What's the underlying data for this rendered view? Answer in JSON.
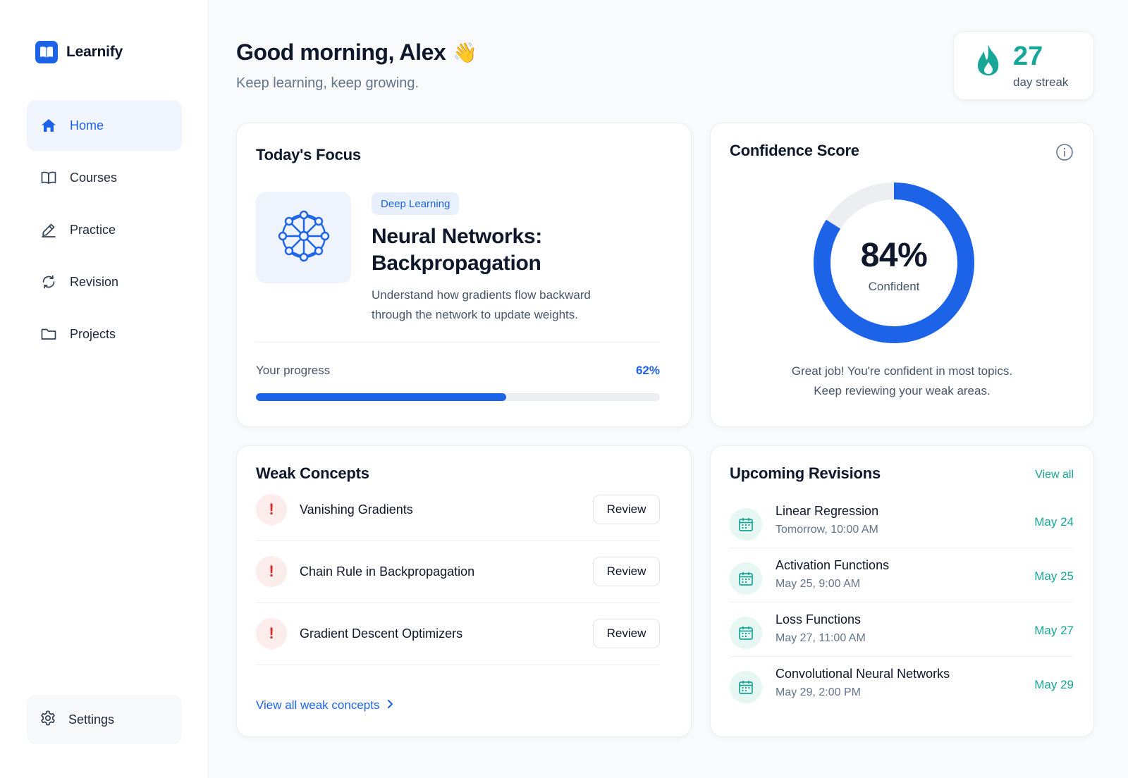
{
  "brand": {
    "name": "Learnify",
    "accent": "#1d63e8"
  },
  "nav": {
    "items": [
      {
        "label": "Home",
        "icon": "home-icon",
        "active": true
      },
      {
        "label": "Courses",
        "icon": "book-icon",
        "active": false
      },
      {
        "label": "Practice",
        "icon": "pencil-icon",
        "active": false
      },
      {
        "label": "Revision",
        "icon": "refresh-icon",
        "active": false
      },
      {
        "label": "Projects",
        "icon": "folder-icon",
        "active": false
      }
    ],
    "settings_label": "Settings"
  },
  "header": {
    "greeting": "Good morning, Alex",
    "emoji": "👋",
    "subtitle": "Keep learning, keep growing."
  },
  "streak": {
    "value": "27",
    "label": "day streak",
    "color": "#17a697"
  },
  "focus": {
    "title": "Today's Focus",
    "tag": "Deep Learning",
    "lesson_title": "Neural Networks: Backpropagation",
    "description": "Understand how gradients flow backward through the network to update weights.",
    "progress_label": "Your progress",
    "progress_text": "62%",
    "progress_value": 0.62
  },
  "confidence": {
    "title": "Confidence Score",
    "value_text": "84%",
    "value": 0.84,
    "label": "Confident",
    "message_line1": "Great job! You're confident in most topics.",
    "message_line2": "Keep reviewing your weak areas."
  },
  "weak": {
    "title": "Weak Concepts",
    "items": [
      {
        "name": "Vanishing Gradients",
        "action": "Review"
      },
      {
        "name": "Chain Rule in Backpropagation",
        "action": "Review"
      },
      {
        "name": "Gradient Descent Optimizers",
        "action": "Review"
      }
    ],
    "view_all": "View all weak concepts"
  },
  "revisions": {
    "title": "Upcoming Revisions",
    "view_all": "View all",
    "items": [
      {
        "title": "Linear Regression",
        "time": "Tomorrow, 10:00 AM",
        "date": "May 24"
      },
      {
        "title": "Activation Functions",
        "time": "May 25, 9:00 AM",
        "date": "May 25"
      },
      {
        "title": "Loss Functions",
        "time": "May 27, 11:00 AM",
        "date": "May 27"
      },
      {
        "title": "Convolutional Neural Networks",
        "time": "May 29, 2:00 PM",
        "date": "May 29"
      }
    ]
  }
}
